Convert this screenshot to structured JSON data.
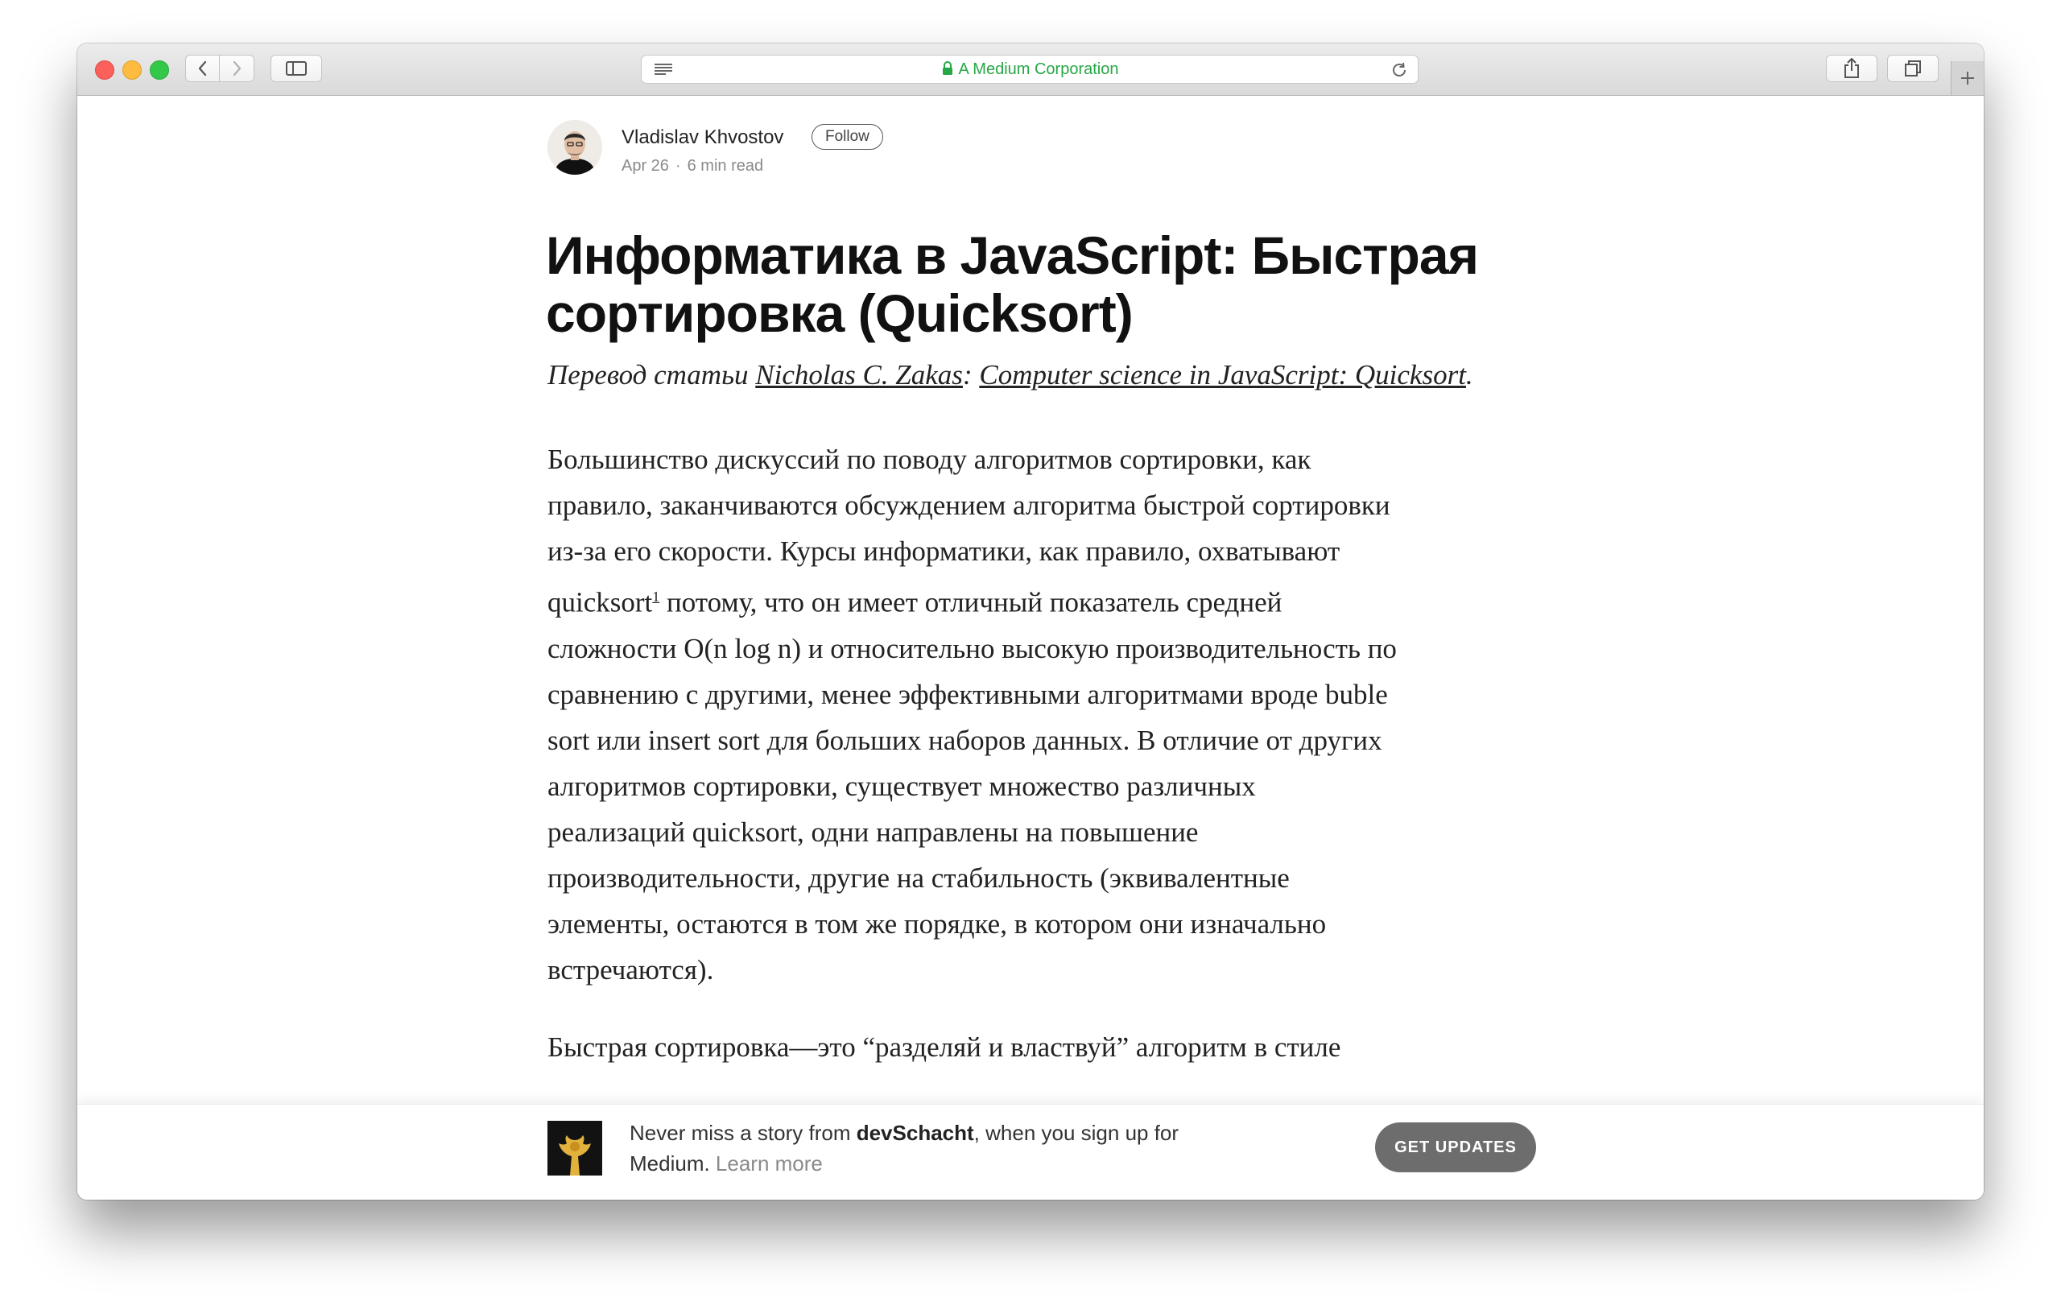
{
  "browser": {
    "address_text": "A Medium Corporation"
  },
  "author": {
    "name": "Vladislav Khvostov",
    "follow_label": "Follow",
    "date": "Apr 26",
    "separator": "·",
    "read_time": "6 min read"
  },
  "article": {
    "title_line1": "Информатика в JavaScript: Быстрая",
    "title_line2": "сортировка (Quicksort)",
    "subtitle_prefix": "Перевод статьи ",
    "subtitle_author": "Nicholas C. Zakas",
    "subtitle_colon": ": ",
    "subtitle_link": "Computer science in JavaScript: Quicksort",
    "subtitle_end": ".",
    "p1_line1": "Большинство дискуссий по поводу алгоритмов сортировки, как",
    "p1_line2": "правило, заканчиваются обсуждением алгоритма быстрой сортировки",
    "p1_line3": "из-за его скорости. Курсы информатики, как правило, охватывают",
    "p1_line4_a": "quicksort",
    "p1_line4_sup": "1",
    "p1_line4_b": " потому, что он имеет отличный показатель средней",
    "p1_line5": "сложности O(n log n) и относительно высокую производительность по",
    "p1_line6": "сравнению с другими, менее эффективными алгоритмами вроде buble",
    "p1_line7": "sort или insert sort для больших наборов данных. В отличие от других",
    "p1_line8": "алгоритмов сортировки, существует множество различных",
    "p1_line9": "реализаций quicksort, одни направлены на повышение",
    "p1_line10": "производительности, другие на стабильность (эквивалентные",
    "p1_line11": "элементы, остаются в том же порядке, в котором они изначально",
    "p1_line12": "встречаются).",
    "p2_line1": "Быстрая сортировка—это “разделяй и властвуй” алгоритм в стиле"
  },
  "signup": {
    "text_a": "Never miss a story from ",
    "publication": "devSchacht",
    "text_b": ", when you sign up for",
    "text_c": "Medium. ",
    "learn_more": "Learn more",
    "button_label": "GET UPDATES"
  },
  "colors": {
    "secure_green": "#27a745",
    "button_gray": "#6d6d6d"
  },
  "icons": [
    "back-chevron-icon",
    "forward-chevron-icon",
    "sidebar-icon",
    "reader-icon",
    "lock-icon",
    "reload-icon",
    "share-icon",
    "tabs-icon",
    "plus-icon"
  ]
}
